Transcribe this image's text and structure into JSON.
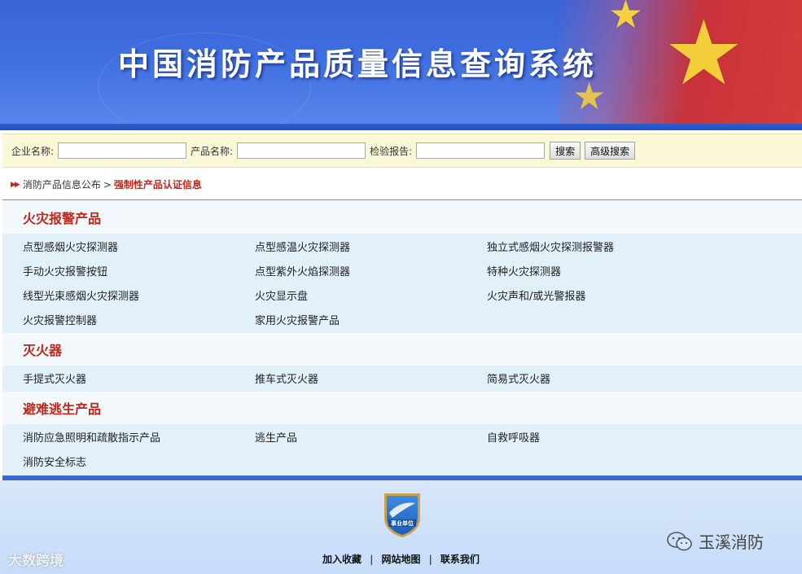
{
  "banner": {
    "title": "中国消防产品质量信息查询系统"
  },
  "search": {
    "company_label": "企业名称:",
    "company_value": "",
    "product_label": "产品名称:",
    "product_value": "",
    "report_label": "检验报告:",
    "report_value": "",
    "search_button": "搜索",
    "advanced_button": "高级搜索"
  },
  "breadcrumb": {
    "arrow": "▶▶",
    "parent": "消防产品信息公布",
    "separator": ">",
    "current": "强制性产品认证信息"
  },
  "categories": [
    {
      "title": "火灾报警产品",
      "rows": [
        [
          "点型感烟火灾探测器",
          "点型感温火灾探测器",
          "独立式感烟火灾探测报警器"
        ],
        [
          "手动火灾报警按钮",
          "点型紫外火焰探测器",
          "特种火灾探测器"
        ],
        [
          "线型光束感烟火灾探测器",
          "火灾显示盘",
          "火灾声和/或光警报器"
        ],
        [
          "火灾报警控制器",
          "家用火灾报警产品",
          ""
        ]
      ]
    },
    {
      "title": "灭火器",
      "rows": [
        [
          "手提式灭火器",
          "推车式灭火器",
          "简易式灭火器"
        ]
      ]
    },
    {
      "title": "避难逃生产品",
      "rows": [
        [
          "消防应急照明和疏散指示产品",
          "逃生产品",
          "自救呼吸器"
        ],
        [
          "消防安全标志",
          "",
          ""
        ]
      ]
    }
  ],
  "footer": {
    "badge_text": "事业单位",
    "link_bookmark": "加入收藏",
    "link_sitemap": "网站地图",
    "link_contact": "联系我们",
    "link_sep": "|"
  },
  "watermarks": {
    "right": "玉溪消防",
    "left": "大数跨境"
  },
  "colors": {
    "accent_red": "#c0281c",
    "banner_blue": "#3f6fe0",
    "search_bg": "#fbf8d8",
    "content_bg": "#e2f0fa"
  }
}
